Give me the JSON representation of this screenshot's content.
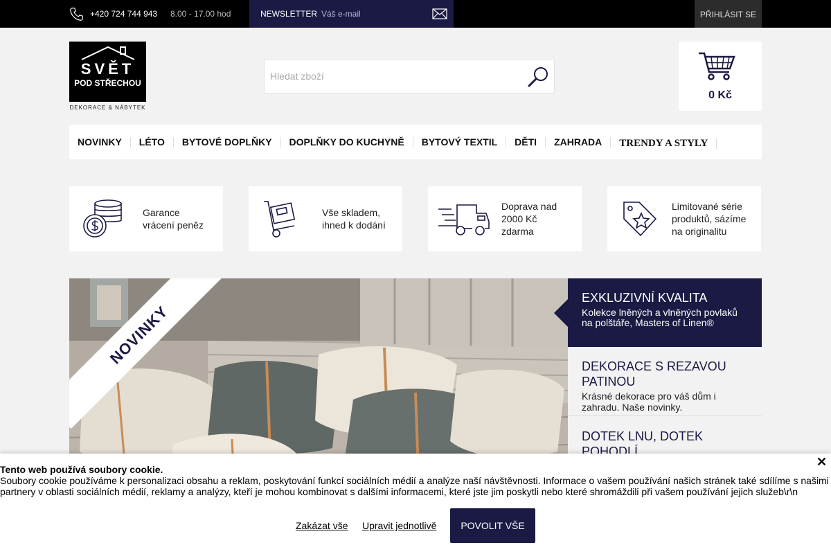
{
  "topbar": {
    "phone": "+420 724 744 943",
    "hours": "8.00 - 17.00 hod",
    "newsletter_label": "NEWSLETTER",
    "newsletter_placeholder": "Váš e-mail",
    "login_label": "PŘIHLÁSIT SE"
  },
  "header": {
    "logo_line1": "SVĚT",
    "logo_line2": "POD STŘECHOU",
    "logo_tagline": "DEKORACE & NÁBYTEK",
    "search_placeholder": "Hledat zboží",
    "cart_total": "0 Kč"
  },
  "nav": {
    "items": [
      {
        "label": "NOVINKY"
      },
      {
        "label": "LÉTO"
      },
      {
        "label": "BYTOVÉ DOPLŇKY"
      },
      {
        "label": "DOPLŇKY DO KUCHYNĚ"
      },
      {
        "label": "BYTOVÝ TEXTIL"
      },
      {
        "label": "DĚTI"
      },
      {
        "label": "ZAHRADA"
      },
      {
        "label": "TRENDY A STYLY"
      }
    ]
  },
  "features": [
    {
      "icon": "coins-icon",
      "text": "Garance vrácení peněz"
    },
    {
      "icon": "hand-truck-icon",
      "text": "Vše skladem, ihned k dodání"
    },
    {
      "icon": "delivery-truck-icon",
      "text": "Doprava nad 2000 Kč zdarma"
    },
    {
      "icon": "star-tag-icon",
      "text": "Limitované série produktů, sázíme na originalitu"
    }
  ],
  "hero": {
    "ribbon": "NOVINKY"
  },
  "side_panels": [
    {
      "title": "EXKLUZIVNÍ KVALITA",
      "description": "Kolekce lněných a vlněných povlaků na polštáře, Masters of Linen®"
    },
    {
      "title": "DEKORACE S REZAVOU PATINOU",
      "description": "Krásné dekorace pro váš dům i zahradu. Naše novinky."
    },
    {
      "title": "DOTEK LNU, DOTEK POHODLÍ",
      "description": ""
    }
  ],
  "cookie": {
    "title": "Tento web používá soubory cookie.",
    "text": "Soubory cookie používáme k personalizaci obsahu a reklam, poskytování funkcí sociálních médií a analýze naší návštěvnosti. Informace o vašem používání našich stránek také sdílíme s našimi partnery v oblasti sociálních médií, reklamy a analýzy, kteří je mohou kombinovat s dalšími informacemi, které jste jim poskytli nebo které shromáždili při vašem používání jejich služeb\\r\\n",
    "close": "✕",
    "deny_label": "Zakázat vše",
    "customize_label": "Upravit jednotlivě",
    "allow_label": "POVOLIT VŠE"
  },
  "colors": {
    "brand_navy": "#1b1a44",
    "topbar": "#000000",
    "background": "#f2f2f2"
  }
}
